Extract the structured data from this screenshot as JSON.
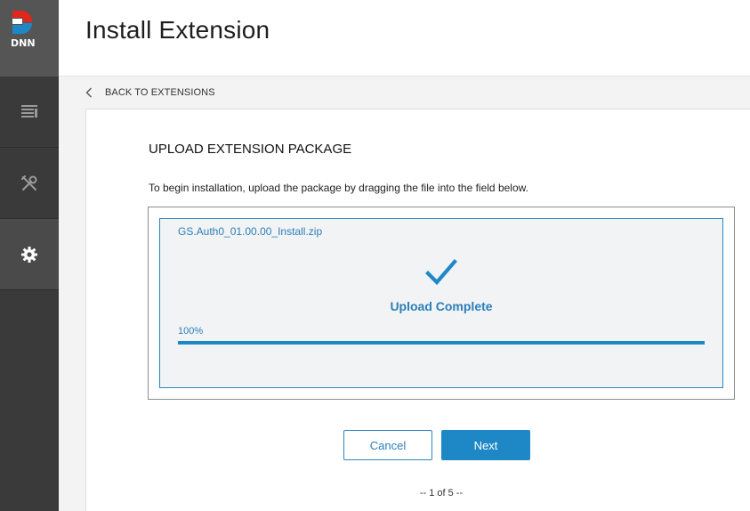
{
  "sidebar": {
    "logo_text": "DNN",
    "items": [
      {
        "name": "pages",
        "icon": "pages-icon"
      },
      {
        "name": "tools",
        "icon": "tools-icon"
      },
      {
        "name": "settings",
        "icon": "gear-icon"
      }
    ]
  },
  "header": {
    "title": "Install Extension"
  },
  "nav": {
    "back_label": "BACK TO EXTENSIONS"
  },
  "upload": {
    "section_title": "UPLOAD EXTENSION PACKAGE",
    "instructions": "To begin installation, upload the package by dragging the file into the field below.",
    "file_name": "GS.Auth0_01.00.00_Install.zip",
    "status": "Upload Complete",
    "progress_label": "100%",
    "progress_value": 1.0
  },
  "actions": {
    "cancel_label": "Cancel",
    "next_label": "Next"
  },
  "pager": {
    "label": "-- 1 of 5 --"
  },
  "colors": {
    "accent": "#1e88c7",
    "sidebar": "#3a3a3a",
    "logo_red": "#e1261c",
    "logo_blue": "#1e88c7"
  }
}
